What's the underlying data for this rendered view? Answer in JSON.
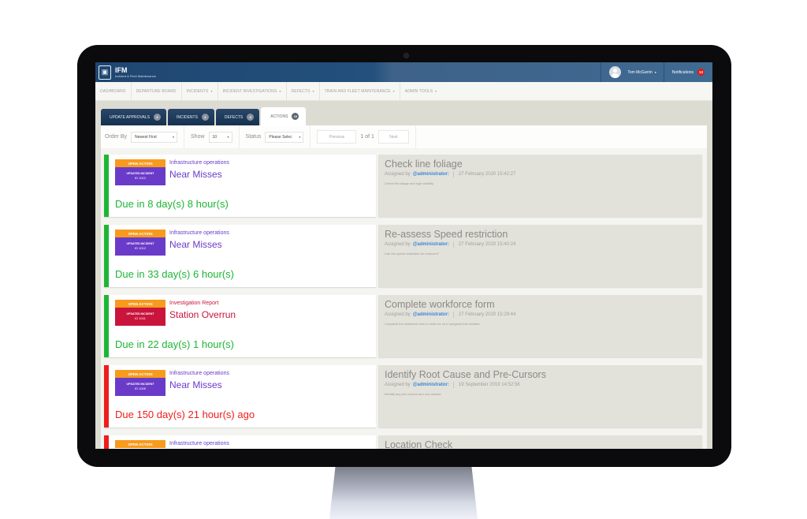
{
  "app": {
    "logo_icon": "clipboard-train-icon",
    "title": "IFM",
    "subtitle": "Incident & Fleet Maintenance"
  },
  "header": {
    "user_name": "Tom McGurrin",
    "user_caret": "▾",
    "notifications_label": "Notifications",
    "notifications_count": "13"
  },
  "nav": {
    "items": [
      {
        "label": "DASHBOARD",
        "caret": ""
      },
      {
        "label": "DEPARTURE BOARD",
        "caret": ""
      },
      {
        "label": "INCIDENTS",
        "caret": "▾"
      },
      {
        "label": "INCIDENT INVESTIGATIONS",
        "caret": "▾"
      },
      {
        "label": "DEFECTS",
        "caret": "▾"
      },
      {
        "label": "TRAIN AND FLEET MAINTENANCE",
        "caret": "▾"
      },
      {
        "label": "ADMIN TOOLS",
        "caret": "▾"
      }
    ]
  },
  "tabs": [
    {
      "label": "UPDATE APPROVALS",
      "count": "0",
      "active": false
    },
    {
      "label": "INCIDENTS",
      "count": "3",
      "active": false
    },
    {
      "label": "DEFECTS",
      "count": "0",
      "active": false
    },
    {
      "label": "ACTIONS",
      "count": "10",
      "active": true
    }
  ],
  "filters": {
    "order_by_label": "Order By",
    "order_by_value": "Newest First",
    "show_label": "Show",
    "show_value": "10",
    "status_label": "Status",
    "status_value": "Please Selec",
    "caret": "▾",
    "previous_label": "Previous",
    "page_text": "1 of 1",
    "next_label": "Next"
  },
  "colors": {
    "on_time": "#1db535",
    "overdue": "#ef1c1c",
    "open_action": "#f79a1d",
    "near_miss": "#6a3bc8",
    "investigation": "#c9153c",
    "assigned_link": "#3a87d6"
  },
  "actions": [
    {
      "open_label": "OPEN ACTION",
      "incident_label": "UPDATED INCIDENT",
      "incident_id": "ID 1012",
      "category": "Infrastructure operations",
      "incident_title": "Near Misses",
      "incident_type": "near_miss",
      "due_text": "Due in 8 day(s) 8 hour(s)",
      "overdue": false,
      "title": "Check line foliage",
      "assigned_prefix": "Assigned by",
      "assigned_by": "@administrator:",
      "date": "27 February 2020 15:42:27",
      "description": "Check the foliage and sign visibility"
    },
    {
      "open_label": "OPEN ACTION",
      "incident_label": "UPDATED INCIDENT",
      "incident_id": "ID 1012",
      "category": "Infrastructure operations",
      "incident_title": "Near Misses",
      "incident_type": "near_miss",
      "due_text": "Due in 33 day(s) 6 hour(s)",
      "overdue": false,
      "title": "Re-assess Speed restriction",
      "assigned_prefix": "Assigned by",
      "assigned_by": "@administrator:",
      "date": "27 February 2020 15:40:24",
      "description": "Can the speed restriction be removed?"
    },
    {
      "open_label": "OPEN ACTION",
      "incident_label": "UPDATED INCIDENT",
      "incident_id": "ID 1011",
      "category": "Investigation Report",
      "incident_title": "Station Overrun",
      "incident_type": "investigation",
      "due_text": "Due in 22 day(s) 1 hour(s)",
      "overdue": false,
      "title": "Complete workforce form",
      "assigned_prefix": "Assigned by",
      "assigned_by": "@administrator:",
      "date": "27 February 2020 15:29:44",
      "description": "Complete the workforce form in order for us to progress this incident."
    },
    {
      "open_label": "OPEN ACTION",
      "incident_label": "UPDATED INCIDENT",
      "incident_id": "ID 1005",
      "category": "Infrastructure operations",
      "incident_title": "Near Misses",
      "incident_type": "near_miss",
      "due_text": "Due 150 day(s) 21 hour(s) ago",
      "overdue": true,
      "title": "Identify Root Cause and Pre-Cursors",
      "assigned_prefix": "Assigned by",
      "assigned_by": "@administrator:",
      "date": "19 September 2019 14:52:58",
      "description": "Identify any pre-cursors and root causes"
    },
    {
      "open_label": "OPEN ACTION",
      "incident_label": "",
      "incident_id": "",
      "category": "Infrastructure operations",
      "incident_title": "",
      "incident_type": "near_miss",
      "due_text": "",
      "overdue": true,
      "title": "Location Check",
      "assigned_prefix": "",
      "assigned_by": "",
      "date": "",
      "description": ""
    }
  ]
}
